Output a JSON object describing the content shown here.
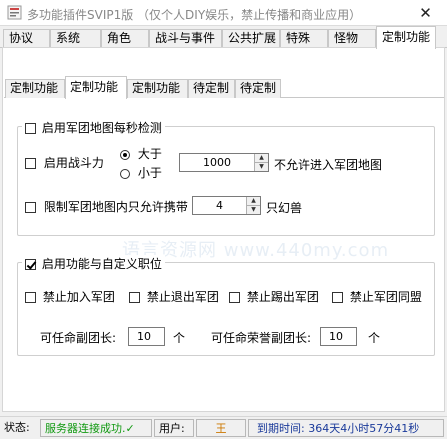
{
  "window": {
    "title": "多功能插件SVIP1版 （仅个人DIY娱乐，禁止传播和商业应用）",
    "close_glyph": "✕"
  },
  "main_tabs": [
    {
      "label": "协议"
    },
    {
      "label": "系统"
    },
    {
      "label": "角色"
    },
    {
      "label": "战斗与事件"
    },
    {
      "label": "公共扩展"
    },
    {
      "label": "特殊"
    },
    {
      "label": "怪物"
    },
    {
      "label": "定制功能"
    }
  ],
  "sub_tabs": [
    {
      "label": "定制功能"
    },
    {
      "label": "定制功能"
    },
    {
      "label": "定制功能"
    },
    {
      "label": "待定制"
    },
    {
      "label": "待定制"
    }
  ],
  "group1": {
    "title": "启用军团地图每秒检测",
    "checked": false,
    "combat": {
      "label": "启用战斗力",
      "greater": "大于",
      "less": "小于",
      "value": "1000",
      "suffix": "不允许进入军团地图"
    },
    "limit": {
      "label": "限制军团地图内只允许携带",
      "value": "4",
      "suffix": "只幻兽"
    }
  },
  "group2": {
    "title": "启用功能与自定义职位",
    "checked": true,
    "options": [
      {
        "label": "禁止加入军团"
      },
      {
        "label": "禁止退出军团"
      },
      {
        "label": "禁止踢出军团"
      },
      {
        "label": "禁止军团同盟"
      }
    ],
    "vice_leader": {
      "label": "可任命副团长:",
      "value": "10",
      "unit": "个"
    },
    "honor_leader": {
      "label": "可任命荣誉副团长:",
      "value": "10",
      "unit": "个"
    }
  },
  "watermark": "语言资源网 www.440my.com",
  "status": {
    "state_label": "状态:",
    "state_value": "服务器连接成功.✓",
    "state_color": "#119911",
    "user_label": "用户:",
    "user_value": "王",
    "user_color": "#cc7700",
    "expire": "到期时间: 364天4小时57分41秒",
    "expire_color": "#1a3a9a"
  }
}
